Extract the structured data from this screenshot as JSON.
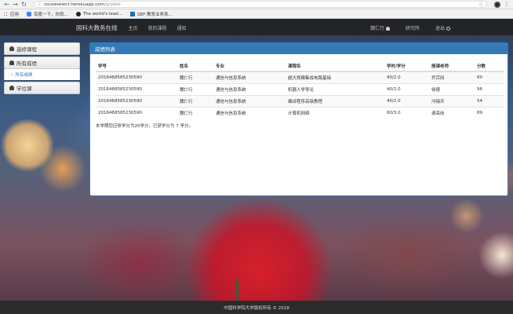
{
  "browser": {
    "url_host": "couseselect.herokuapp.com",
    "url_path": "/grades",
    "bookmarks": [
      "应用",
      "百度一下，你就...",
      "The world's lead...",
      "SEP 教育业务系..."
    ]
  },
  "navbar": {
    "brand": "国科大教务在线",
    "links": [
      "主页",
      "我的课程",
      "通知"
    ],
    "user": "魏仁行",
    "profile": "研究所",
    "logout": "退出"
  },
  "sidebar": {
    "items": [
      {
        "label": "选修课程"
      },
      {
        "label": "所有成绩"
      },
      {
        "label": "学位课"
      }
    ],
    "sub_label": "所有成绩"
  },
  "panel": {
    "title": "成绩列表",
    "columns": [
      "学号",
      "姓名",
      "专业",
      "课程名",
      "学时/学分",
      "授课老师",
      "分数"
    ],
    "rows": [
      [
        "2016468585230590",
        "魏仁行",
        "通信与信息系统",
        "超大规模集成电路基础",
        "40/2.0",
        "乔宗田",
        "60"
      ],
      [
        "2016468585230590",
        "魏仁行",
        "通信与信息系统",
        "机器人学导论",
        "40/2.0",
        "徐德",
        "96"
      ],
      [
        "2016468585230590",
        "魏仁行",
        "通信与信息系统",
        "编译程序高级教程",
        "40/2.0",
        "冯瑞兵",
        "54"
      ],
      [
        "2016468585230590",
        "魏仁行",
        "通信与信息系统",
        "计算机网络",
        "60/3.0",
        "谢高岗",
        "89"
      ]
    ],
    "summary": "本学期您应修学分为20学分，已获学分为 7 学分。"
  },
  "footer": {
    "text": "中国科学院大学版权所有 © 2018"
  }
}
